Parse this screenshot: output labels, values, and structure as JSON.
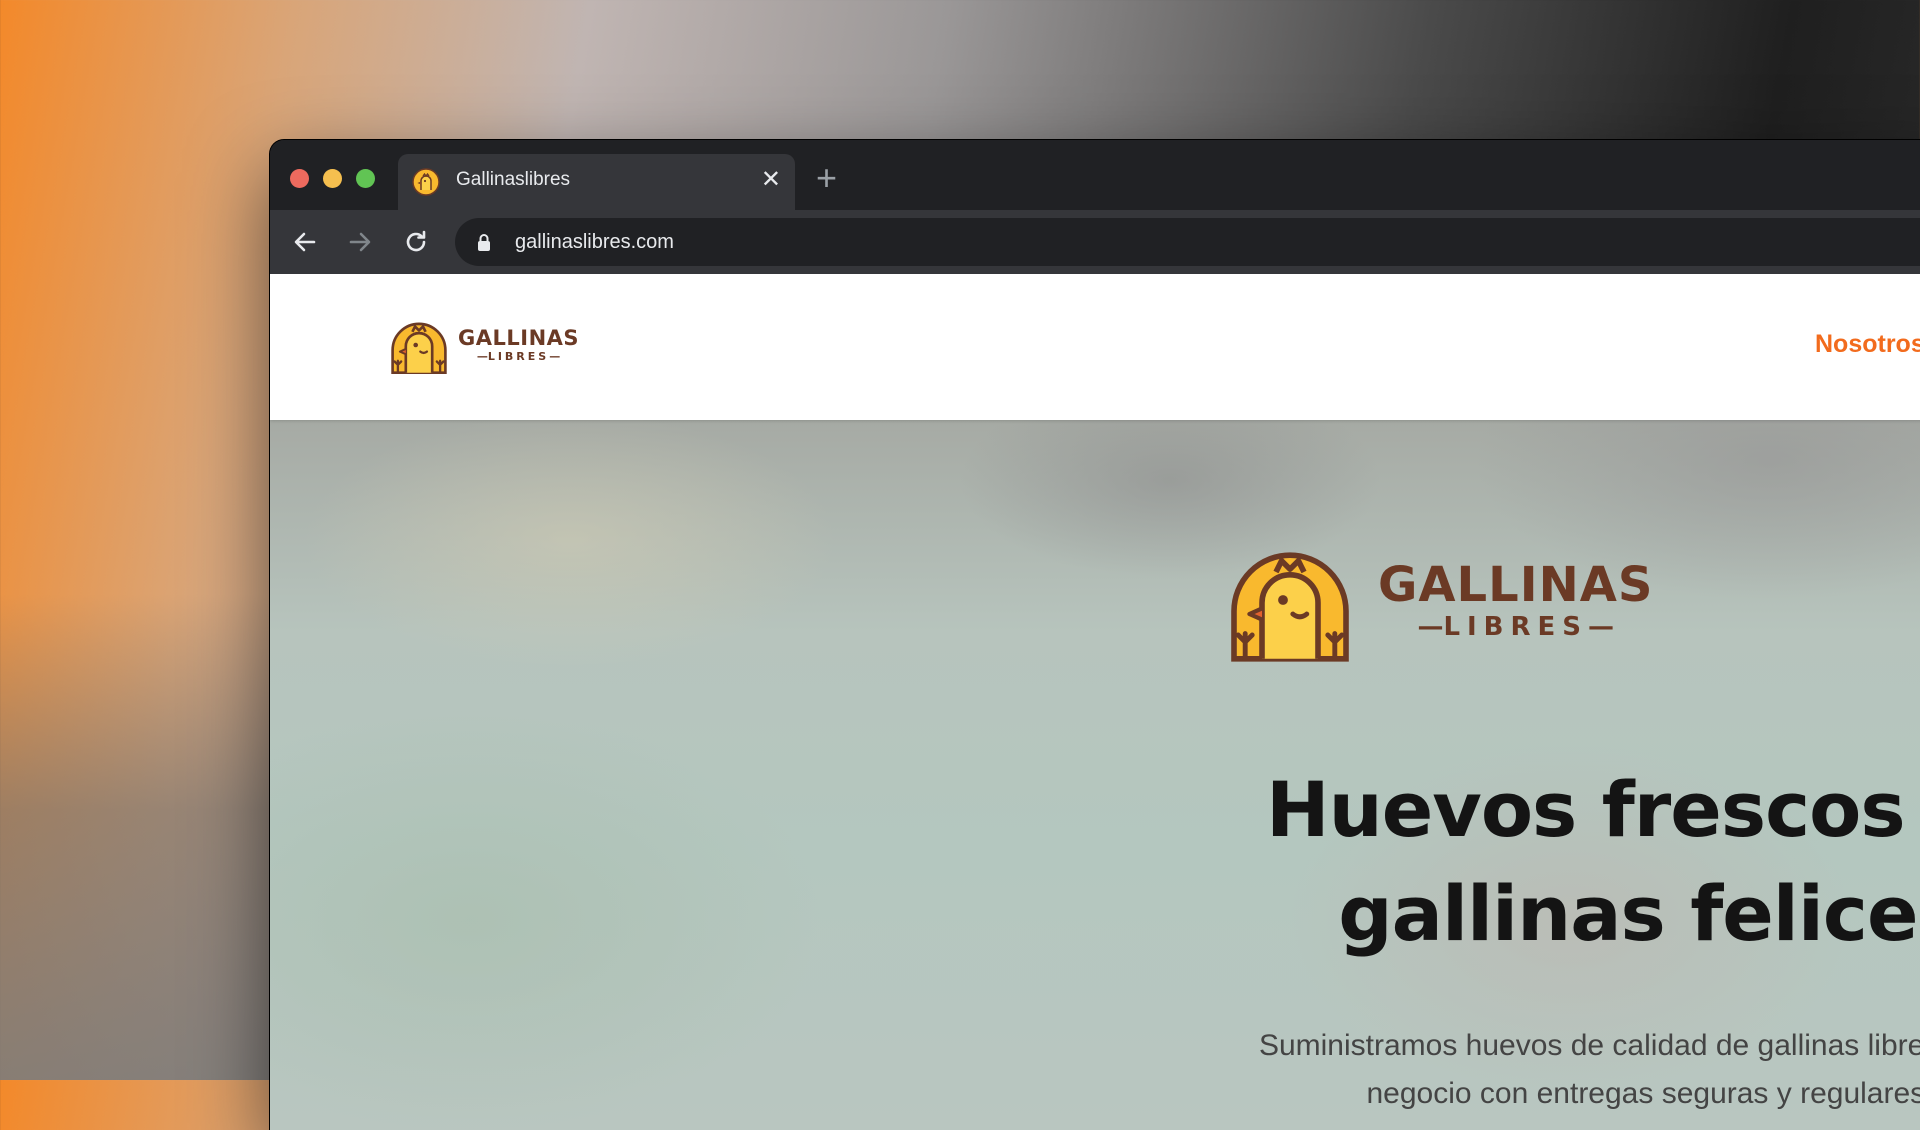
{
  "browser": {
    "tab": {
      "title": "Gallinaslibres",
      "close_symbol": "✕",
      "favicon": "chicken-logo-icon"
    },
    "new_tab_symbol": "+",
    "url": "gallinaslibres.com",
    "icons": {
      "back": "arrow-left-icon",
      "forward": "arrow-right-icon",
      "reload": "reload-icon",
      "lock": "lock-icon"
    }
  },
  "site": {
    "logo": {
      "word": "GALLINAS",
      "sub": "LIBRES"
    },
    "nav": {
      "nosotros": "Nosotros"
    },
    "hero": {
      "title_line1": "Huevos frescos de",
      "title_line2": "gallinas felices",
      "subtitle_line1": "Suministramos huevos de calidad de gallinas libres para tu",
      "subtitle_line2": "negocio con entregas seguras y regulares."
    }
  },
  "colors": {
    "accent": "#f26b1d",
    "logo_yellow": "#f9b92e",
    "logo_brown": "#6b3a25",
    "browser_dark": "#202124",
    "browser_tab": "#35363a"
  }
}
